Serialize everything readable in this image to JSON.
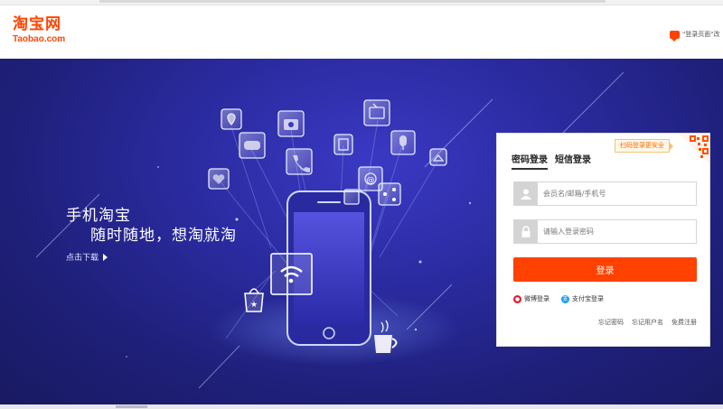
{
  "header": {
    "logo_cn": "淘宝网",
    "logo_en": "Taobao.com",
    "feedback_text": "\"登录页面\"改",
    "brand_color": "#ff4400"
  },
  "banner": {
    "slogan_line1": "手机淘宝",
    "slogan_line2": "随时随地，想淘就淘",
    "download_label": "点击下载",
    "background_color": "#2a2a9e",
    "icons": [
      "location-pin-icon",
      "camera-icon",
      "tv-icon",
      "gamepad-icon",
      "phone-call-icon",
      "clipboard-icon",
      "microphone-icon",
      "mail-icon",
      "share-icon",
      "heart-icon",
      "hanger-icon",
      "shopping-bag-icon",
      "wifi-icon",
      "coffee-cup-icon",
      "smartphone-icon"
    ]
  },
  "login": {
    "tabs": [
      {
        "label": "密码登录",
        "active": true
      },
      {
        "label": "短信登录",
        "active": false
      }
    ],
    "qr_tip": "扫码登录更安全",
    "username_placeholder": "会员名/邮箱/手机号",
    "password_placeholder": "请输入登录密码",
    "submit_label": "登录",
    "submit_color": "#ff4200",
    "weibo_label": "微博登录",
    "alipay_label": "支付宝登录",
    "links": {
      "forgot_password": "忘记密码",
      "forgot_username": "忘记用户名",
      "register": "免费注册"
    }
  }
}
